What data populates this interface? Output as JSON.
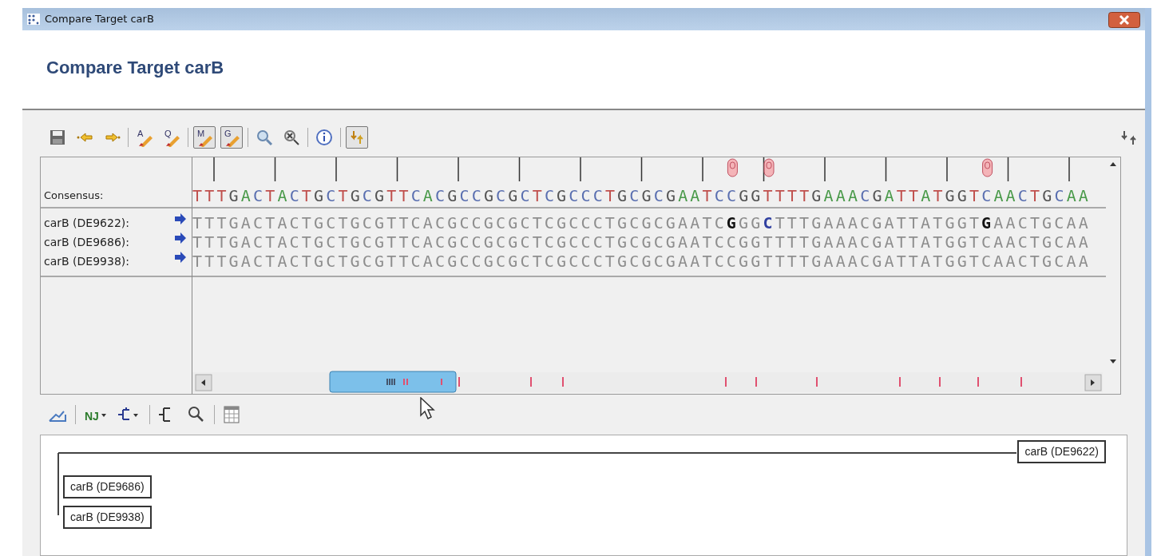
{
  "window": {
    "title": "Compare Target carB"
  },
  "header": {
    "title": "Compare Target carB"
  },
  "toolbar": [
    {
      "kind": "save",
      "pressed": false
    },
    {
      "kind": "back",
      "pressed": false
    },
    {
      "kind": "forward",
      "pressed": false
    },
    {
      "kind": "separator"
    },
    {
      "kind": "letter-pen",
      "glyph": "A",
      "pressed": false
    },
    {
      "kind": "letter-pen",
      "glyph": "Q",
      "pressed": false
    },
    {
      "kind": "separator"
    },
    {
      "kind": "letter-pen",
      "glyph": "M",
      "pressed": true
    },
    {
      "kind": "letter-pen",
      "glyph": "G",
      "pressed": true
    },
    {
      "kind": "separator"
    },
    {
      "kind": "zoom-in",
      "pressed": false
    },
    {
      "kind": "zoom-out",
      "pressed": false
    },
    {
      "kind": "separator"
    },
    {
      "kind": "info",
      "pressed": false
    },
    {
      "kind": "separator"
    },
    {
      "kind": "swap",
      "pressed": true
    }
  ],
  "alignment": {
    "consensus_label": "Consensus:",
    "consensus": "TTTGACTACTGCTGCGTTCACGCCGCGCTCGCCCTGCGCGAATCCGGTTTTGAAACGATTATGGTCAACTGCAA",
    "rows": [
      {
        "label": "carB (DE9622):",
        "sequence": "TTTGACTACTGCTGCGTTCACGCCGCGCTCGCCCTGCGCGAATC**G**GG**C**TTTGAAACGATTATGGT**G**AACTGCAA"
      },
      {
        "label": "carB (DE9686):",
        "sequence": "TTTGACTACTGCTGCGTTCACGCCGCGCTCGCCCTGCGCGAATCCGGTTTTGAAACGATTATGGTCAACTGCAA"
      },
      {
        "label": "carB (DE9938):",
        "sequence": "TTTGACTACTGCTGCGTTCACGCCGCGCTCGCCCTGCGCGAATCCGGTTTTGAAACGATTATGGTCAACTGCAA"
      }
    ]
  },
  "tree_toolbar": [
    {
      "kind": "export"
    },
    {
      "kind": "separator"
    },
    {
      "kind": "nj-menu",
      "glyph": "NJ"
    },
    {
      "kind": "tree-menu"
    },
    {
      "kind": "separator"
    },
    {
      "kind": "tree"
    },
    {
      "kind": "search"
    },
    {
      "kind": "separator"
    },
    {
      "kind": "table"
    }
  ],
  "tree": {
    "leaves": [
      {
        "label": "carB (DE9622)"
      },
      {
        "label": "carB (DE9686)"
      },
      {
        "label": "carB (DE9938)"
      }
    ]
  }
}
